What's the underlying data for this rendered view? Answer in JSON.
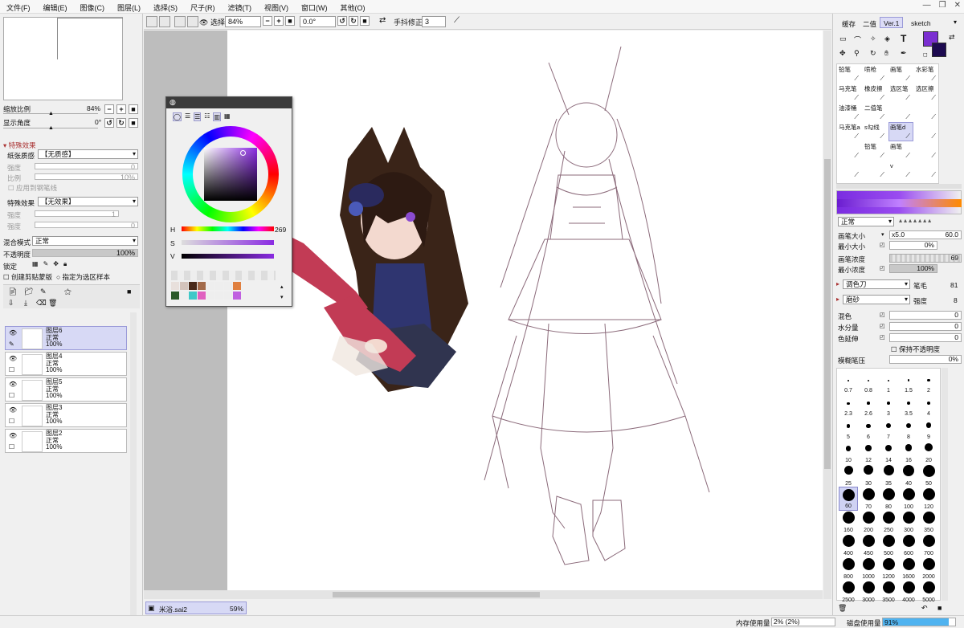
{
  "menu": [
    "文件(F)",
    "编辑(E)",
    "图像(C)",
    "图层(L)",
    "选择(S)",
    "尺子(R)",
    "滤镜(T)",
    "视图(V)",
    "窗口(W)",
    "其他(O)"
  ],
  "navigator": {
    "zoom_label": "缩放比例",
    "zoom_value": "84%",
    "angle_label": "显示角度",
    "angle_value": "0°"
  },
  "effects": {
    "section_title": "特殊效果",
    "paper_label": "纸张质感",
    "paper_value": "【无质感】",
    "strength_label": "强度",
    "strength_value": "0",
    "ratio_label": "比例",
    "ratio_value": "10%",
    "apply_outline": "应用到钢笔线",
    "effect_label": "特殊效果",
    "effect_value": "【无效果】",
    "effect_strength_label": "强度",
    "effect_strength_value": "1",
    "effect_strength2_label": "强度",
    "effect_strength2_value": "0"
  },
  "blend": {
    "mode_label": "混合模式",
    "mode_value": "正常",
    "opacity_label": "不透明度",
    "opacity_value": "100%",
    "lock_label": "锁定",
    "clip_label": "创建剪贴蒙版",
    "select_source_label": "指定为选区样本"
  },
  "layers": [
    {
      "name": "图层6",
      "mode": "正常",
      "opacity": "100%",
      "selected": true
    },
    {
      "name": "图层4",
      "mode": "正常",
      "opacity": "100%",
      "selected": false
    },
    {
      "name": "图层5",
      "mode": "正常",
      "opacity": "100%",
      "selected": false
    },
    {
      "name": "图层3",
      "mode": "正常",
      "opacity": "100%",
      "selected": false
    },
    {
      "name": "图层2",
      "mode": "正常",
      "opacity": "100%",
      "selected": false
    }
  ],
  "toolbar": {
    "select_label": "选择",
    "zoom_value": "84%",
    "angle_value": "0.0°",
    "stabilizer_label": "手抖修正",
    "stabilizer_value": "3"
  },
  "document": {
    "name": "米浴.sai2",
    "zoom": "59%"
  },
  "status": {
    "memory_label": "内存使用量",
    "memory_value": "2% (2%)",
    "disk_label": "磁盘使用量",
    "disk_value": "91%",
    "disk_fraction": 0.91
  },
  "color_panel": {
    "h_label": "H",
    "h_value": "269",
    "s_label": "S",
    "v_label": "V",
    "current_color": "#7b2fd1"
  },
  "right_tabs": [
    "缓存",
    "二值",
    "Ver.1",
    "sketch"
  ],
  "brushes": [
    [
      "铅笔",
      "喷枪",
      "画笔",
      "水彩笔"
    ],
    [
      "马克笔",
      "橡皮擦",
      "选区笔",
      "选区擦"
    ],
    [
      "油漆桶",
      "二值笔",
      "",
      ""
    ],
    [
      "马克笔a",
      "s勾线",
      "画笔d",
      ""
    ],
    [
      "",
      "铅笔",
      "画笔",
      ""
    ],
    [
      "",
      "",
      "v",
      ""
    ]
  ],
  "brush_settings": {
    "blend_mode": "正常",
    "size_label": "画笔大小",
    "size_mult": "x5.0",
    "size_value": "60.0",
    "min_size_label": "最小大小",
    "min_size_value": "0%",
    "density_label": "画笔浓度",
    "density_value": "69",
    "min_density_label": "最小浓度",
    "min_density_value": "100%",
    "shape1_value": "调色刀",
    "shape1_label": "笔毛",
    "shape1_num": "81",
    "shape2_value": "磨砂",
    "shape2_label": "强度",
    "shape2_num": "8",
    "mix_label": "混色",
    "mix_value": "0",
    "water_label": "水分量",
    "water_value": "0",
    "stretch_label": "色延伸",
    "stretch_value": "0",
    "keep_opacity_label": "保持不透明度",
    "blur_label": "模糊笔压",
    "blur_value": "0%"
  },
  "brush_sizes": [
    "0.7",
    "0.8",
    "1",
    "1.5",
    "2",
    "2.3",
    "2.6",
    "3",
    "3.5",
    "4",
    "5",
    "6",
    "7",
    "8",
    "9",
    "10",
    "12",
    "14",
    "16",
    "20",
    "25",
    "30",
    "35",
    "40",
    "50",
    "60",
    "70",
    "80",
    "100",
    "120",
    "160",
    "200",
    "250",
    "300",
    "350",
    "400",
    "450",
    "500",
    "600",
    "700",
    "800",
    "1000",
    "1200",
    "1600",
    "2000",
    "2500",
    "3000",
    "3500",
    "4000",
    "5000"
  ],
  "selected_brush_size": "60"
}
